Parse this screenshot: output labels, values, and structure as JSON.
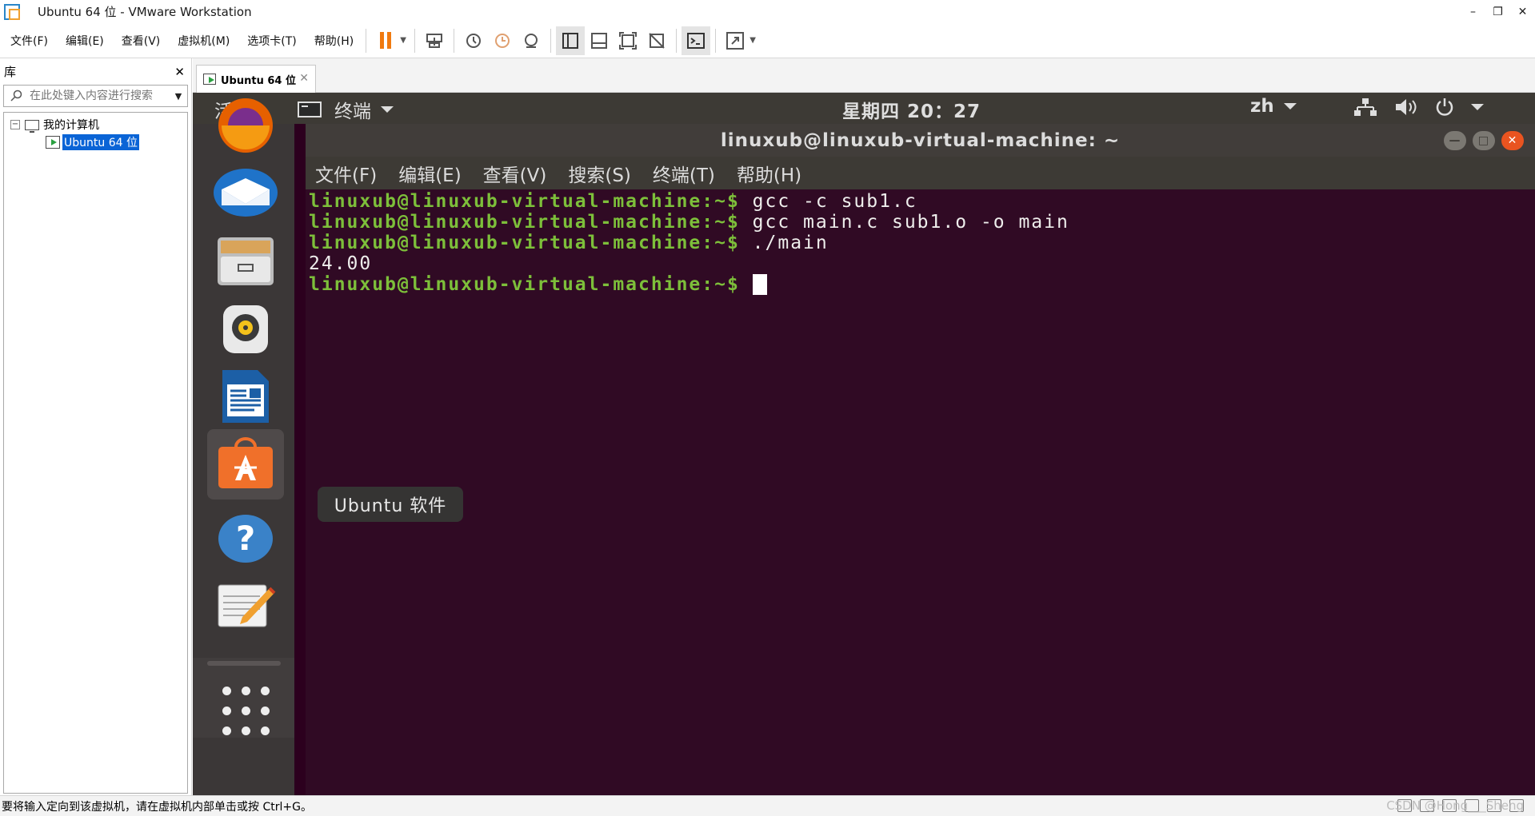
{
  "window": {
    "title": "Ubuntu 64 位 - VMware Workstation",
    "controls": {
      "minimize": "–",
      "restore": "❐",
      "close": "✕"
    }
  },
  "menubar": {
    "file": "文件(F)",
    "edit": "编辑(E)",
    "view": "查看(V)",
    "vm": "虚拟机(M)",
    "tabs": "选项卡(T)",
    "help": "帮助(H)"
  },
  "library": {
    "title": "库",
    "close": "✕",
    "search_placeholder": "在此处键入内容进行搜索",
    "tree": {
      "root": "我的计算机",
      "vm": "Ubuntu 64 位"
    }
  },
  "tab": {
    "label": "Ubuntu 64 位",
    "close": "✕"
  },
  "ubuntu": {
    "topbar": {
      "activities": "活动",
      "app": "终端",
      "clock": "星期四 20：27",
      "lang": "zh"
    },
    "terminal": {
      "title": "linuxub@linuxub-virtual-machine: ~",
      "menu": [
        "文件(F)",
        "编辑(E)",
        "查看(V)",
        "搜索(S)",
        "终端(T)",
        "帮助(H)"
      ],
      "lines": [
        {
          "prompt": "linuxub@linuxub-virtual-machine:~$",
          "cmd": " gcc -c sub1.c"
        },
        {
          "prompt": "linuxub@linuxub-virtual-machine:~$",
          "cmd": " gcc main.c sub1.o -o main"
        },
        {
          "prompt": "linuxub@linuxub-virtual-machine:~$",
          "cmd": " ./main"
        },
        {
          "prompt": "",
          "cmd": "24.00"
        },
        {
          "prompt": "linuxub@linuxub-virtual-machine:~$",
          "cmd": " "
        }
      ]
    },
    "tooltip": "Ubuntu 软件"
  },
  "statusbar": {
    "message": "要将输入定向到该虚拟机，请在虚拟机内部单击或按 Ctrl+G。",
    "watermark": "CSDN @Hong___Sheng"
  },
  "colors": {
    "terminal_bg": "#300a24",
    "prompt_green": "#7dbf3a",
    "ubuntu_orange": "#e95420"
  }
}
